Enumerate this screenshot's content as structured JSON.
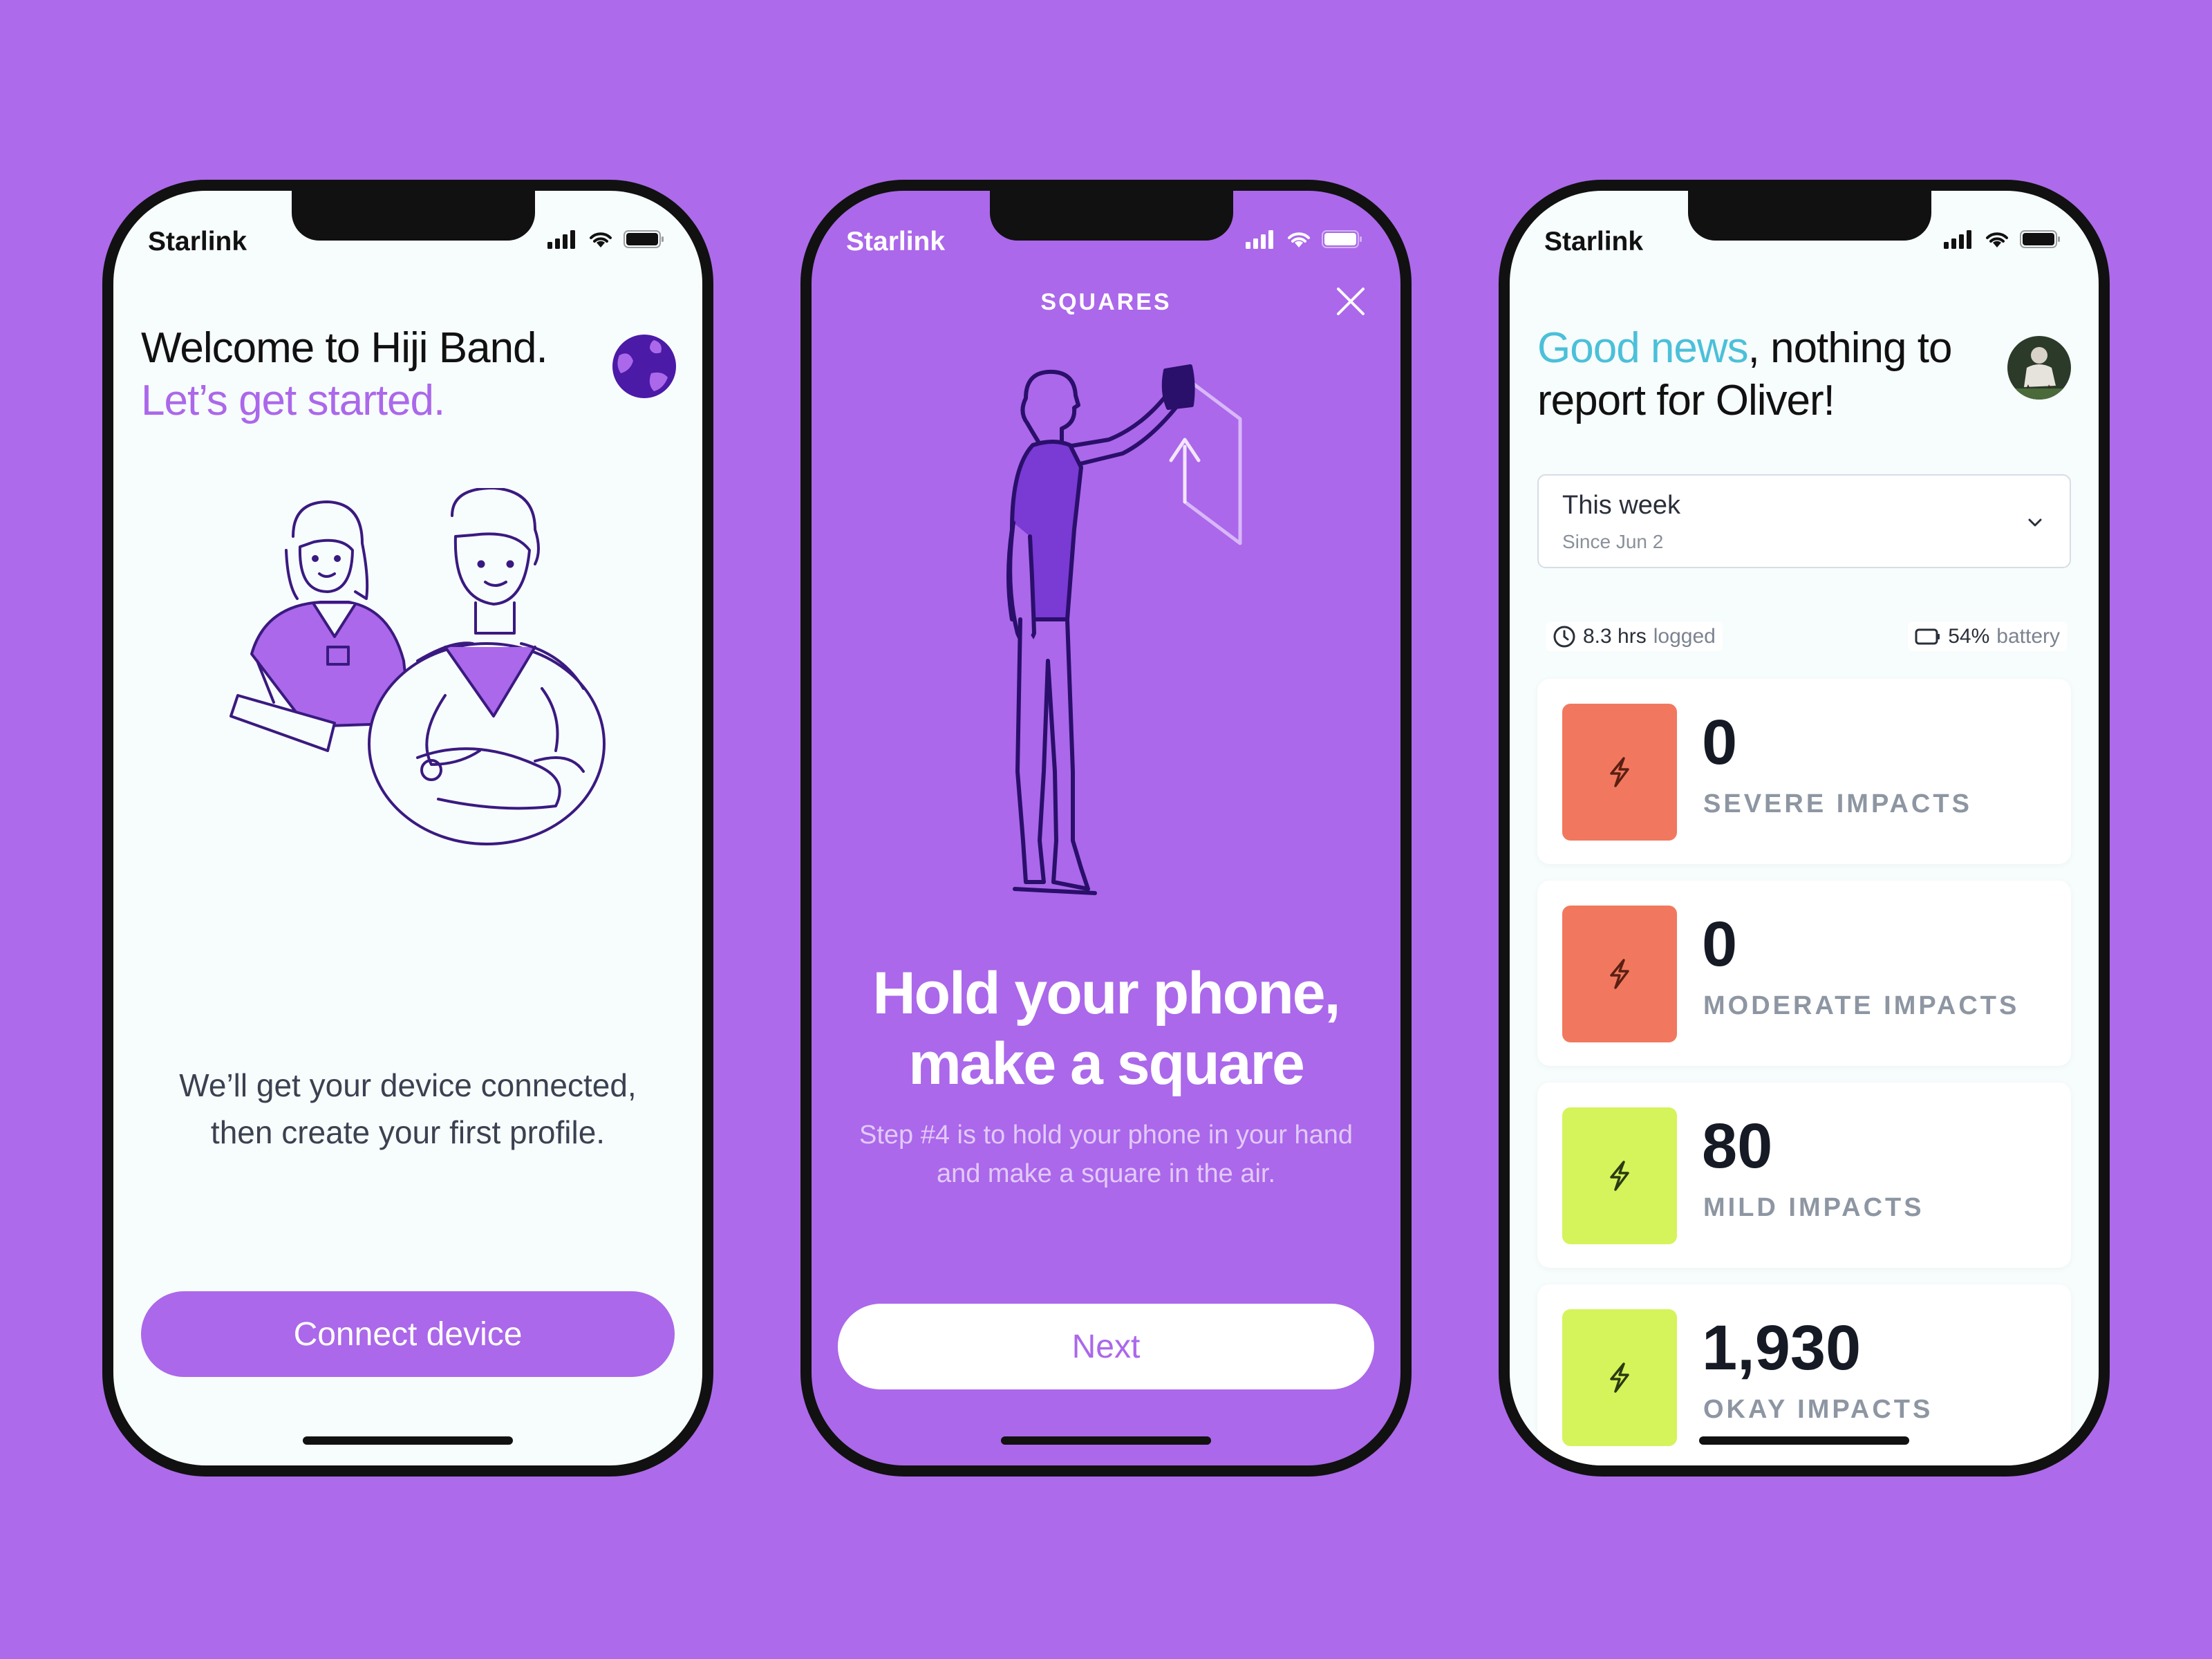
{
  "colors": {
    "background": "#ad6aea",
    "accent_purple": "#ab68ea",
    "teal_highlight": "#4bc0d9",
    "severe_tile": "#f1785e",
    "mild_tile": "#d5f35b"
  },
  "status_bar": {
    "carrier": "Starlink"
  },
  "onboarding": {
    "title": "Welcome to Hiji Band.",
    "subtitle": "Let’s get started.",
    "description": "We’ll get your device connected, then create your first profile.",
    "connect_button": "Connect device"
  },
  "squares": {
    "header": "SQUARES",
    "title": "Hold your phone, make a square",
    "description": "Step #4 is to hold your phone in your hand and make a square in the air.",
    "next_button": "Next"
  },
  "report": {
    "title_highlight": "Good news",
    "title_rest": ", nothing to report for Oliver!",
    "period": {
      "selected": "This week",
      "since": "Since Jun 2"
    },
    "logged": {
      "value": "8.3 hrs",
      "label": "logged"
    },
    "battery": {
      "value": "54%",
      "label": "battery"
    },
    "impacts": [
      {
        "value": "0",
        "label": "SEVERE IMPACTS",
        "tile_color": "#f1785e"
      },
      {
        "value": "0",
        "label": "MODERATE IMPACTS",
        "tile_color": "#f1785e"
      },
      {
        "value": "80",
        "label": "MILD IMPACTS",
        "tile_color": "#d5f35b"
      },
      {
        "value": "1,930",
        "label": "OKAY IMPACTS",
        "tile_color": "#d5f35b"
      }
    ]
  }
}
